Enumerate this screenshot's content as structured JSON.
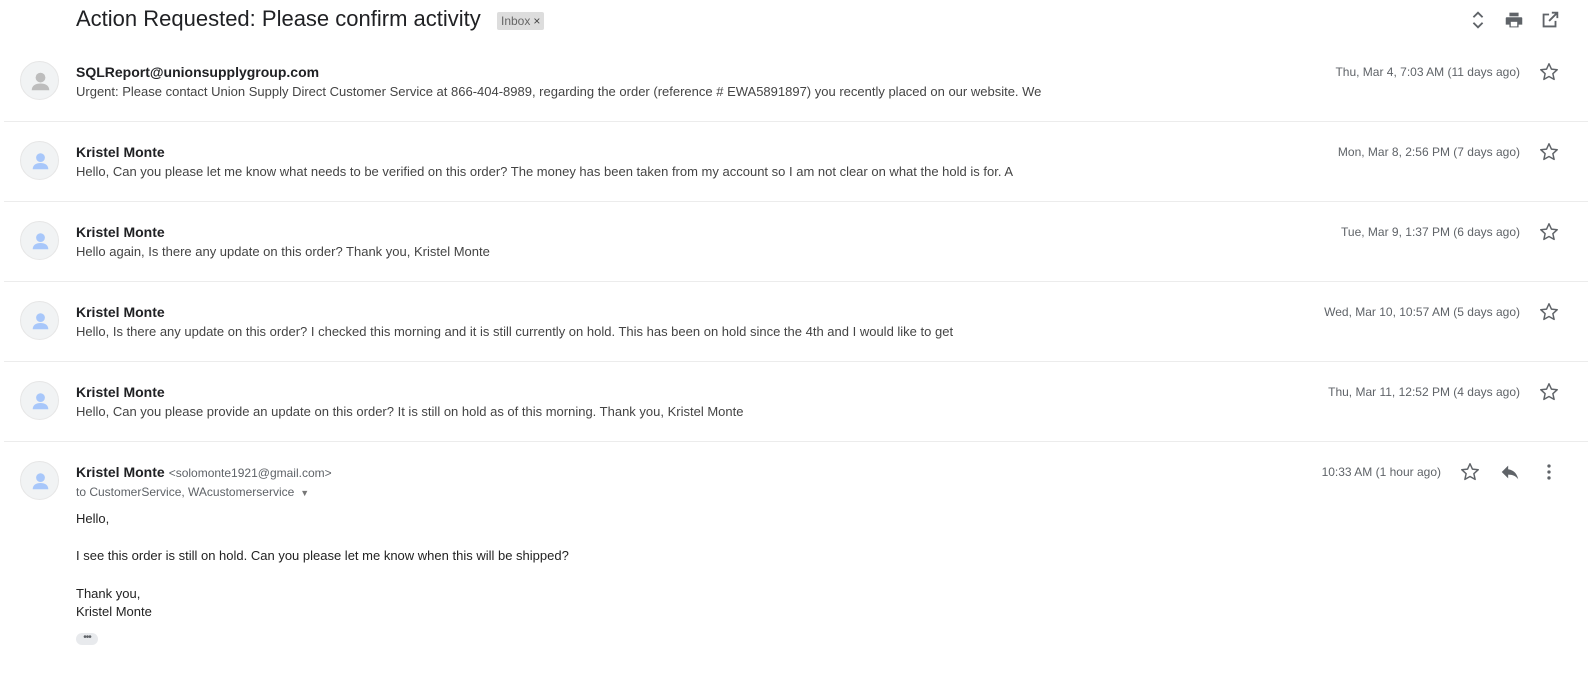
{
  "thread": {
    "subject": "Action Requested: Please confirm activity",
    "label": "Inbox",
    "label_close": "×"
  },
  "header_icons": [
    "expand-all-icon",
    "print-icon",
    "open-in-new-window-icon"
  ],
  "collapsed_messages": [
    {
      "sender": "SQLReport@unionsupplygroup.com",
      "date": "Thu, Mar 4, 7:03 AM (11 days ago)",
      "snippet": "Urgent: Please contact Union Supply Direct Customer Service at 866-404-8989, regarding the order (reference # EWA5891897) you recently placed on our website. We"
    },
    {
      "sender": "Kristel Monte",
      "date": "Mon, Mar 8, 2:56 PM (7 days ago)",
      "snippet": "Hello, Can you please let me know what needs to be verified on this order? The money has been taken from my account so I am not clear on what the hold is for. A"
    },
    {
      "sender": "Kristel Monte",
      "date": "Tue, Mar 9, 1:37 PM (6 days ago)",
      "snippet": "Hello again, Is there any update on this order? Thank you, Kristel Monte"
    },
    {
      "sender": "Kristel Monte",
      "date": "Wed, Mar 10, 10:57 AM (5 days ago)",
      "snippet": "Hello, Is there any update on this order? I checked this morning and it is still currently on hold. This has been on hold since the 4th and I would like to get"
    },
    {
      "sender": "Kristel Monte",
      "date": "Thu, Mar 11, 12:52 PM (4 days ago)",
      "snippet": "Hello, Can you please provide an update on this order? It is still on hold as of this morning. Thank you, Kristel Monte"
    }
  ],
  "open_message": {
    "sender": "Kristel Monte",
    "sender_email": "<solomonte1921@gmail.com>",
    "date": "10:33 AM (1 hour ago)",
    "recipients": "to CustomerService, WAcustomerservice",
    "body": [
      "Hello,",
      "I see this order is still on hold.  Can you please let me know when this will be shipped?",
      "Thank you,",
      "Kristel Monte"
    ],
    "trimmed_content": "•••"
  },
  "colors": {
    "avatar_generic": "#9e9e9e",
    "avatar_person": "#a8c7fa",
    "label_bg": "#dddddd",
    "divider": "#ececec"
  }
}
